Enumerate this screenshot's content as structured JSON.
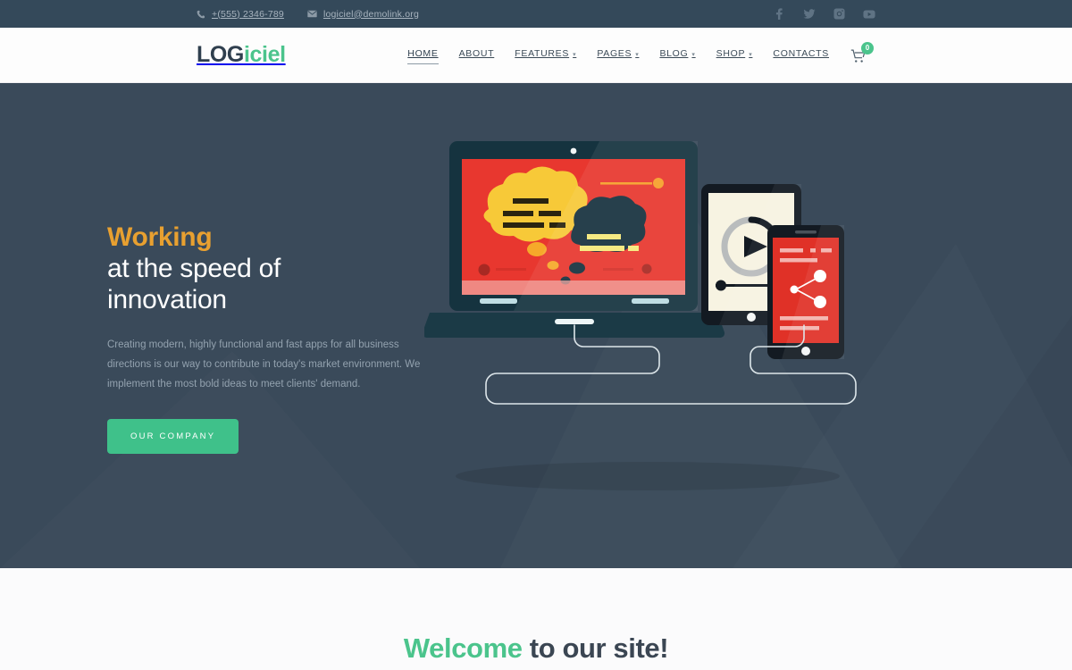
{
  "topbar": {
    "phone": "+(555) 2346-789",
    "email": "logiciel@demolink.org",
    "phone_icon": "phone-icon",
    "email_icon": "envelope-icon",
    "socials": [
      {
        "name": "facebook-icon",
        "label": "Facebook"
      },
      {
        "name": "twitter-icon",
        "label": "Twitter"
      },
      {
        "name": "instagram-icon",
        "label": "Instagram"
      },
      {
        "name": "youtube-icon",
        "label": "YouTube"
      }
    ]
  },
  "header": {
    "logo_dark": "LOG",
    "logo_green": "iciel",
    "nav": [
      {
        "label": "HOME",
        "dropdown": false,
        "active": true
      },
      {
        "label": "ABOUT",
        "dropdown": false,
        "active": false
      },
      {
        "label": "FEATURES",
        "dropdown": true,
        "active": false
      },
      {
        "label": "PAGES",
        "dropdown": true,
        "active": false
      },
      {
        "label": "BLOG",
        "dropdown": true,
        "active": false
      },
      {
        "label": "SHOP",
        "dropdown": true,
        "active": false
      },
      {
        "label": "CONTACTS",
        "dropdown": false,
        "active": false
      }
    ],
    "cart": {
      "icon": "shopping-cart-icon",
      "count": "0"
    }
  },
  "hero": {
    "title_accent": "Working",
    "title_line2": "at the speed of",
    "title_line3": "innovation",
    "paragraph": "Creating modern, highly functional and fast apps for all business directions is our way to contribute in today's market environment. We implement the most bold ideas to meet clients' demand.",
    "cta": "OUR COMPANY",
    "illustration": "devices-laptop-tablet-phone-illustration"
  },
  "welcome": {
    "green": "Welcome",
    "rest": " to our site!"
  },
  "colors": {
    "topbar_bg": "#34495a",
    "hero_bg": "#3a4a5a",
    "brand_green": "#4bc48c",
    "cta_green": "#3fc18a",
    "accent_orange": "#e8a030",
    "screen_red": "#e8372f",
    "bubble_yellow": "#f5c council"
  }
}
